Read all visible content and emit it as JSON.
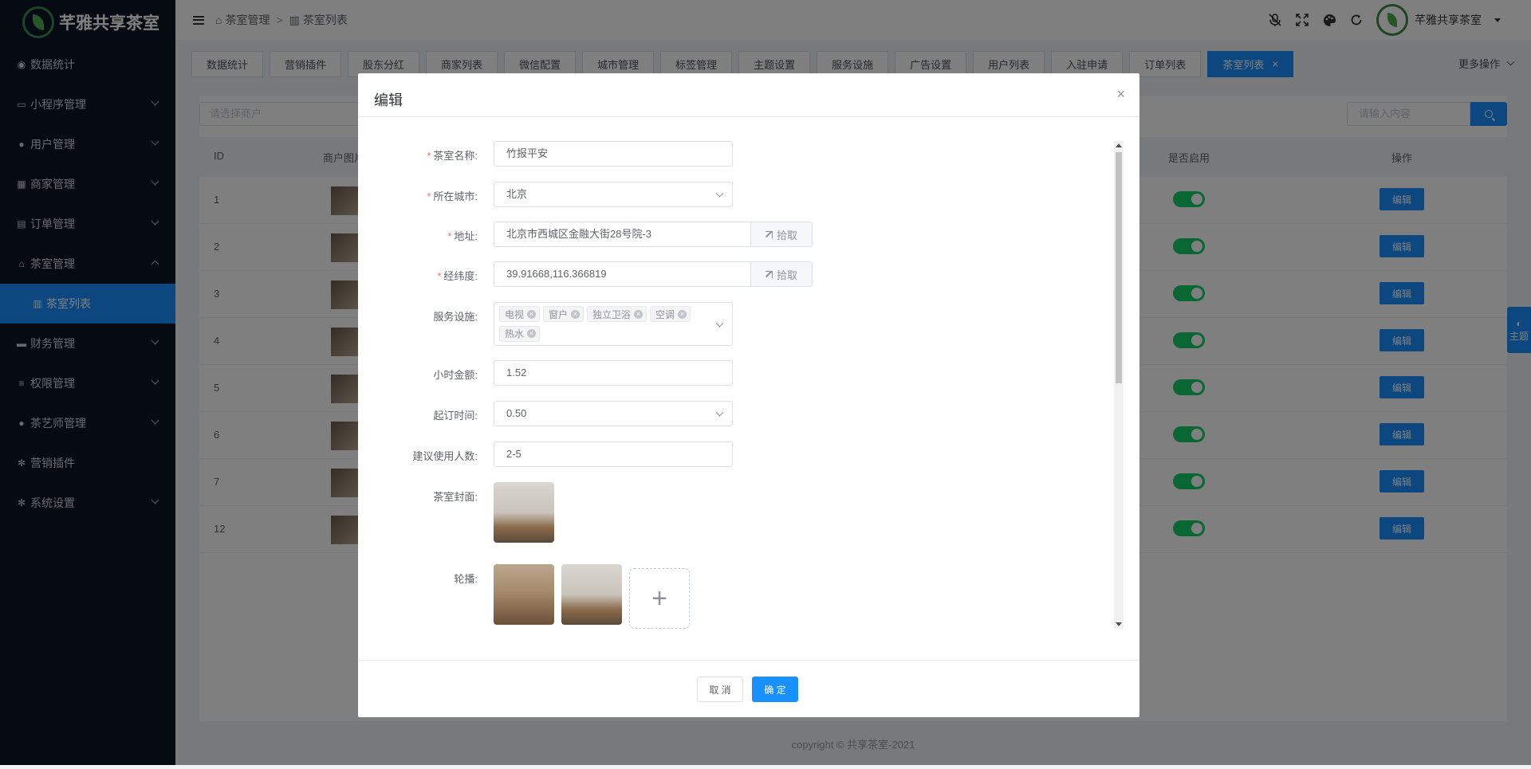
{
  "app": {
    "title": "芊雅共享茶室"
  },
  "sidebar": {
    "items": [
      {
        "label": "数据统计",
        "icon": "dashboard-icon",
        "glyph": "◉",
        "arrow": false
      },
      {
        "label": "小程序管理",
        "icon": "monitor-icon",
        "glyph": "▭",
        "arrow": true
      },
      {
        "label": "用户管理",
        "icon": "users-icon",
        "glyph": "●",
        "arrow": true
      },
      {
        "label": "商家管理",
        "icon": "store-icon",
        "glyph": "▦",
        "arrow": true
      },
      {
        "label": "订单管理",
        "icon": "clipboard-icon",
        "glyph": "▤",
        "arrow": true
      },
      {
        "label": "茶室管理",
        "icon": "home-icon",
        "glyph": "⌂",
        "arrow": true,
        "open": true
      },
      {
        "label": "财务管理",
        "icon": "money-icon",
        "glyph": "▬",
        "arrow": true
      },
      {
        "label": "权限管理",
        "icon": "database-icon",
        "glyph": "≡",
        "arrow": true
      },
      {
        "label": "茶艺师管理",
        "icon": "user-tie-icon",
        "glyph": "●",
        "arrow": true
      },
      {
        "label": "营销插件",
        "icon": "gear-icon",
        "glyph": "✻",
        "arrow": false
      },
      {
        "label": "系统设置",
        "icon": "settings-icon",
        "glyph": "✻",
        "arrow": true
      }
    ],
    "sub_active": {
      "label": "茶室列表",
      "icon": "warehouse-icon"
    }
  },
  "breadcrumb": {
    "home": "茶室管理",
    "sep": ">",
    "current": "茶室列表"
  },
  "header": {
    "user_name": "芊雅共享茶室"
  },
  "tabs": [
    "数据统计",
    "营销插件",
    "股东分红",
    "商家列表",
    "微信配置",
    "城市管理",
    "标签管理",
    "主题设置",
    "服务设施",
    "广告设置",
    "用户列表",
    "入驻申请",
    "订单列表"
  ],
  "active_tab": "茶室列表",
  "more_actions": "更多操作",
  "filter": {
    "merchant_placeholder": "请选择商户",
    "search_placeholder": "请输入内容"
  },
  "table": {
    "headers": {
      "id": "ID",
      "image": "商户图片",
      "enabled": "是否启用",
      "action": "操作"
    },
    "rows": [
      {
        "id": "1",
        "enabled": true
      },
      {
        "id": "2",
        "enabled": true
      },
      {
        "id": "3",
        "enabled": true
      },
      {
        "id": "4",
        "enabled": true
      },
      {
        "id": "5",
        "enabled": true
      },
      {
        "id": "6",
        "enabled": true
      },
      {
        "id": "7",
        "enabled": true
      },
      {
        "id": "12",
        "enabled": true
      }
    ],
    "edit_label": "编辑"
  },
  "footer": "copyright © 共享茶室-2021",
  "theme_button": "主题",
  "dialog": {
    "title": "编辑",
    "fields": {
      "name_label": "茶室名称:",
      "name_value": "竹报平安",
      "city_label": "所在城市:",
      "city_value": "北京",
      "address_label": "地址:",
      "address_value": "北京市西城区金融大街28号院-3",
      "coords_label": "经纬度:",
      "coords_value": "39.91668,116.366819",
      "pick_label": "拾取",
      "facilities_label": "服务设施:",
      "facilities": [
        "电视",
        "窗户",
        "独立卫浴",
        "空调",
        "热水"
      ],
      "hourly_label": "小时金额:",
      "hourly_value": "1.52",
      "min_time_label": "起订时间:",
      "min_time_value": "0.50",
      "people_label": "建议使用人数:",
      "people_value": "2-5",
      "cover_label": "茶室封面:",
      "carousel_label": "轮播:"
    },
    "cancel_label": "取 消",
    "confirm_label": "确 定"
  },
  "colors": {
    "primary": "#1890ff",
    "sidebar_bg": "#0c1527",
    "switch_on": "#13ce66",
    "required": "#f56c6c"
  }
}
